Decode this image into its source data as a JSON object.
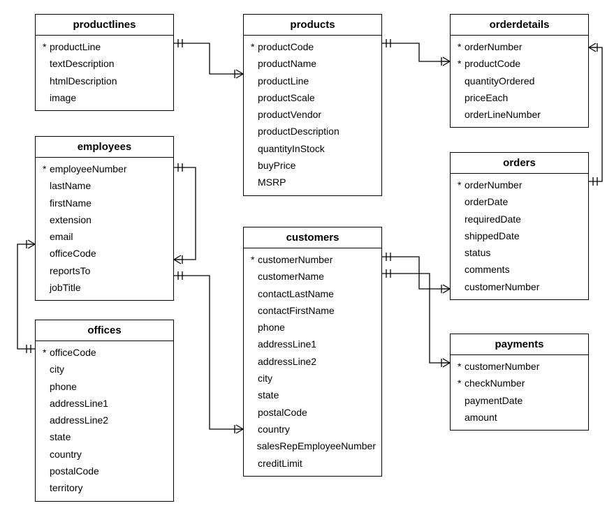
{
  "entities": {
    "productlines": {
      "title": "productlines",
      "fields": [
        {
          "name": "productLine",
          "pk": true
        },
        {
          "name": "textDescription",
          "pk": false
        },
        {
          "name": "htmlDescription",
          "pk": false
        },
        {
          "name": "image",
          "pk": false
        }
      ]
    },
    "products": {
      "title": "products",
      "fields": [
        {
          "name": "productCode",
          "pk": true
        },
        {
          "name": "productName",
          "pk": false
        },
        {
          "name": "productLine",
          "pk": false
        },
        {
          "name": "productScale",
          "pk": false
        },
        {
          "name": "productVendor",
          "pk": false
        },
        {
          "name": "productDescription",
          "pk": false
        },
        {
          "name": "quantityInStock",
          "pk": false
        },
        {
          "name": "buyPrice",
          "pk": false
        },
        {
          "name": "MSRP",
          "pk": false
        }
      ]
    },
    "orderdetails": {
      "title": "orderdetails",
      "fields": [
        {
          "name": "orderNumber",
          "pk": true
        },
        {
          "name": "productCode",
          "pk": true
        },
        {
          "name": "quantityOrdered",
          "pk": false
        },
        {
          "name": "priceEach",
          "pk": false
        },
        {
          "name": "orderLineNumber",
          "pk": false
        }
      ]
    },
    "employees": {
      "title": "employees",
      "fields": [
        {
          "name": "employeeNumber",
          "pk": true
        },
        {
          "name": "lastName",
          "pk": false
        },
        {
          "name": "firstName",
          "pk": false
        },
        {
          "name": "extension",
          "pk": false
        },
        {
          "name": "email",
          "pk": false
        },
        {
          "name": "officeCode",
          "pk": false
        },
        {
          "name": "reportsTo",
          "pk": false
        },
        {
          "name": "jobTitle",
          "pk": false
        }
      ]
    },
    "orders": {
      "title": "orders",
      "fields": [
        {
          "name": "orderNumber",
          "pk": true
        },
        {
          "name": "orderDate",
          "pk": false
        },
        {
          "name": "requiredDate",
          "pk": false
        },
        {
          "name": "shippedDate",
          "pk": false
        },
        {
          "name": "status",
          "pk": false
        },
        {
          "name": "comments",
          "pk": false
        },
        {
          "name": "customerNumber",
          "pk": false
        }
      ]
    },
    "customers": {
      "title": "customers",
      "fields": [
        {
          "name": "customerNumber",
          "pk": true
        },
        {
          "name": "customerName",
          "pk": false
        },
        {
          "name": "contactLastName",
          "pk": false
        },
        {
          "name": "contactFirstName",
          "pk": false
        },
        {
          "name": "phone",
          "pk": false
        },
        {
          "name": "addressLine1",
          "pk": false
        },
        {
          "name": "addressLine2",
          "pk": false
        },
        {
          "name": "city",
          "pk": false
        },
        {
          "name": "state",
          "pk": false
        },
        {
          "name": "postalCode",
          "pk": false
        },
        {
          "name": "country",
          "pk": false
        },
        {
          "name": "salesRepEmployeeNumber",
          "pk": false
        },
        {
          "name": "creditLimit",
          "pk": false
        }
      ]
    },
    "offices": {
      "title": "offices",
      "fields": [
        {
          "name": "officeCode",
          "pk": true
        },
        {
          "name": "city",
          "pk": false
        },
        {
          "name": "phone",
          "pk": false
        },
        {
          "name": "addressLine1",
          "pk": false
        },
        {
          "name": "addressLine2",
          "pk": false
        },
        {
          "name": "state",
          "pk": false
        },
        {
          "name": "country",
          "pk": false
        },
        {
          "name": "postalCode",
          "pk": false
        },
        {
          "name": "territory",
          "pk": false
        }
      ]
    },
    "payments": {
      "title": "payments",
      "fields": [
        {
          "name": "customerNumber",
          "pk": true
        },
        {
          "name": "checkNumber",
          "pk": true
        },
        {
          "name": "paymentDate",
          "pk": false
        },
        {
          "name": "amount",
          "pk": false
        }
      ]
    }
  },
  "relationships": [
    {
      "from": "productlines",
      "to": "products",
      "type": "one-to-many"
    },
    {
      "from": "products",
      "to": "orderdetails",
      "type": "one-to-many"
    },
    {
      "from": "orders",
      "to": "orderdetails",
      "type": "one-to-many"
    },
    {
      "from": "customers",
      "to": "orders",
      "type": "one-to-many"
    },
    {
      "from": "customers",
      "to": "payments",
      "type": "one-to-many"
    },
    {
      "from": "employees",
      "to": "customers",
      "type": "one-to-many"
    },
    {
      "from": "employees",
      "to": "employees",
      "type": "one-to-many-self"
    },
    {
      "from": "offices",
      "to": "employees",
      "type": "one-to-many"
    }
  ]
}
